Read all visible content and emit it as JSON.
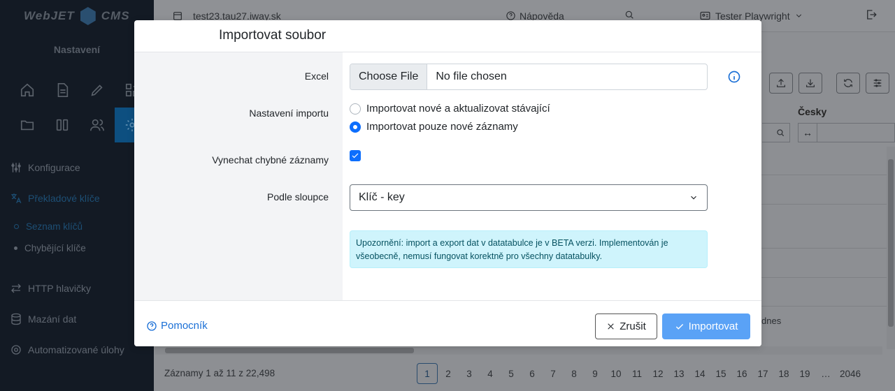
{
  "app": {
    "logo_text_left": "WebJET",
    "logo_text_right": "CMS",
    "section_title": "Nastavení",
    "host": "test23.tau27.iway.sk",
    "help": "Nápověda",
    "user": "Tester Playwright"
  },
  "sidebar": {
    "items": [
      {
        "label": "Konfigurace"
      },
      {
        "label": "Překladové klíče"
      },
      {
        "label": "Seznam klíčů"
      },
      {
        "label": "Chybějící klíče"
      },
      {
        "label": "HTTP hlavičky"
      },
      {
        "label": "Mazání dat"
      },
      {
        "label": "Automatizované úlohy"
      }
    ]
  },
  "background_table": {
    "column_header": "Česky",
    "filter_arrow": "↔",
    "cell_fragment": "dnes",
    "footer": "Záznamy 1 až 11 z 22,498",
    "pages": [
      "1",
      "2",
      "3",
      "4",
      "5",
      "6",
      "7",
      "8",
      "9",
      "10",
      "11",
      "12",
      "13",
      "14",
      "15",
      "16",
      "17",
      "18",
      "19",
      "…",
      "2046"
    ]
  },
  "modal": {
    "title": "Importovat soubor",
    "excel_label": "Excel",
    "file_button": "Choose File",
    "file_status": "No file chosen",
    "import_settings_label": "Nastavení importu",
    "radio_options": [
      {
        "label": "Importovat nové a aktualizovat stávající",
        "checked": false
      },
      {
        "label": "Importovat pouze nové záznamy",
        "checked": true
      }
    ],
    "skip_errors_label": "Vynechat chybné záznamy",
    "skip_errors_checked": true,
    "by_column_label": "Podle sloupce",
    "by_column_value": "Klíč - key",
    "warning": "Upozornění: import a export dat v datatabulce je v BETA verzi. Implementován je všeobecně, nemusí fungovat korektně pro všechny datatabulky.",
    "help_link": "Pomocník",
    "cancel": "Zrušit",
    "submit": "Importovat"
  },
  "colors": {
    "primary": "#0d6efd",
    "submit_bg": "#5aa2f6",
    "link": "#1a6fd6",
    "alert_bg": "#cff4fc",
    "alert_text": "#055160",
    "sidebar_bg": "#131a24"
  }
}
